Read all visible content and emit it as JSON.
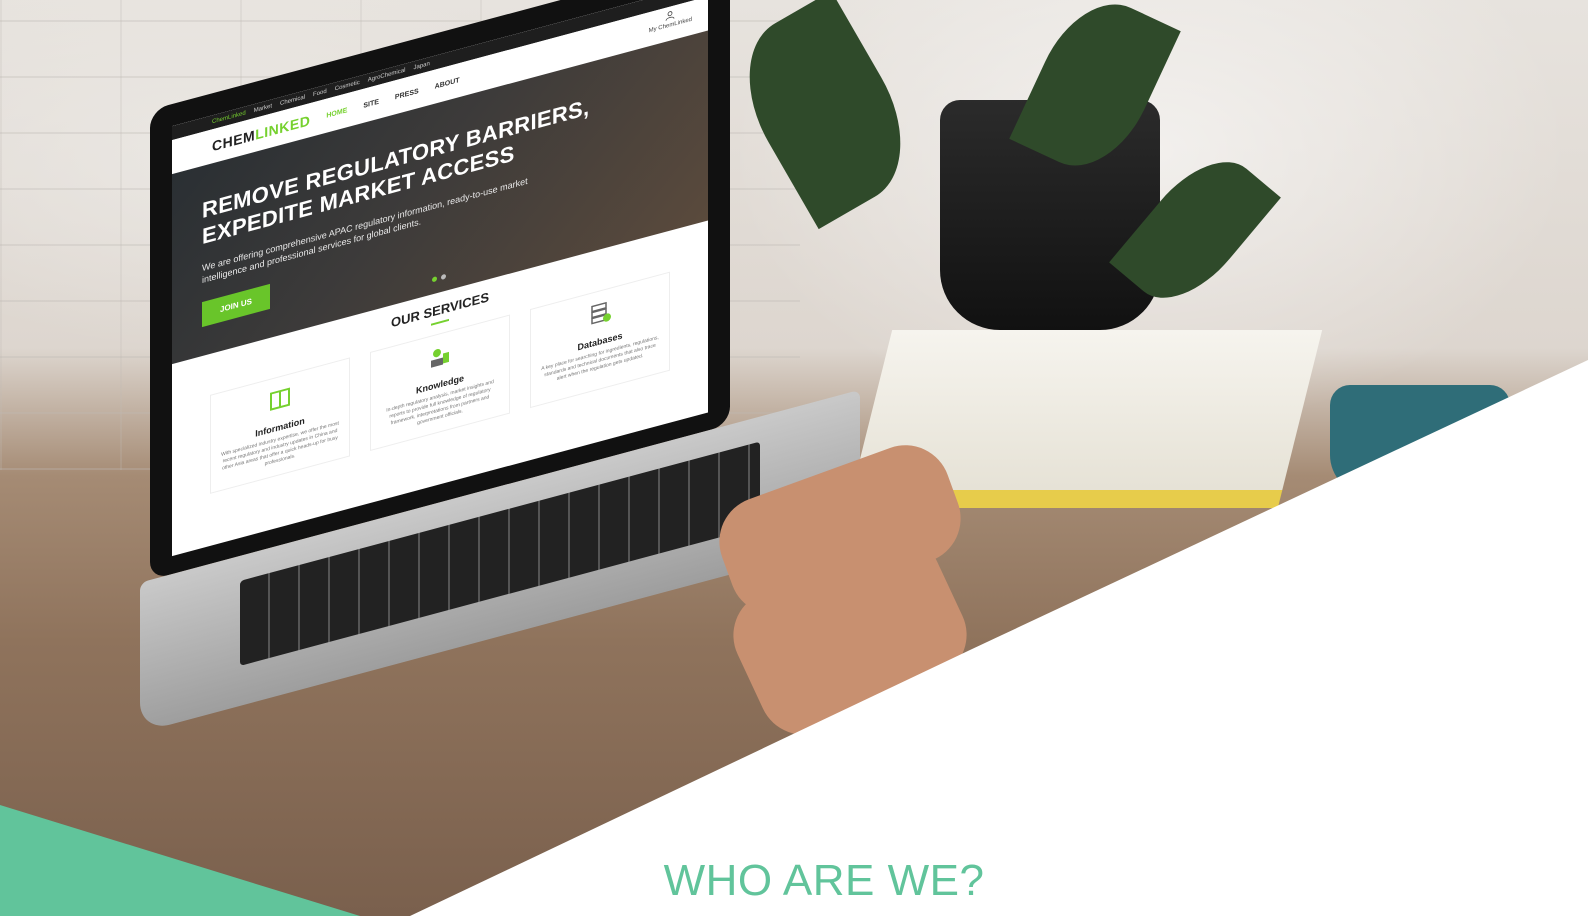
{
  "colors": {
    "accent_green": "#76d12f",
    "teal_green": "#61c49b"
  },
  "laptop_site": {
    "topbar": [
      "ChemLinked",
      "Market",
      "Chemical",
      "Food",
      "Cosmetic",
      "AgroChemical",
      "Japan"
    ],
    "brand": {
      "part1": "CHEM",
      "part2": "LINKED"
    },
    "nav": [
      "HOME",
      "SITE",
      "PRESS",
      "ABOUT"
    ],
    "account_label": "My ChemLinked",
    "hero": {
      "title_line1": "REMOVE  REGULATORY BARRIERS,",
      "title_line2": "EXPEDITE MARKET ACCESS",
      "subtitle": "We are offering comprehensive APAC regulatory information, ready-to-use market intelligence and professional services for global clients.",
      "cta": "JOIN US"
    },
    "services": {
      "heading": "OUR SERVICES",
      "cards": [
        {
          "icon": "information-book-icon",
          "title": "Information",
          "text": "With specialized industry expertise, we offer the most recent regulatory and industry updates in China and other Asia areas that offer a quick heads-up for busy professionals."
        },
        {
          "icon": "knowledge-people-icon",
          "title": "Knowledge",
          "text": "In-depth regulatory analysis, market insights and reports to provide full knowledge of regulatory framework, interpretations from partners and government officials."
        },
        {
          "icon": "databases-stack-icon",
          "title": "Databases",
          "text": "A key place for searching for ingredients, regulations, standards and technical documents that also trace alert when the regulation gets updated."
        }
      ]
    }
  },
  "page": {
    "headline": "WHO ARE WE?"
  }
}
